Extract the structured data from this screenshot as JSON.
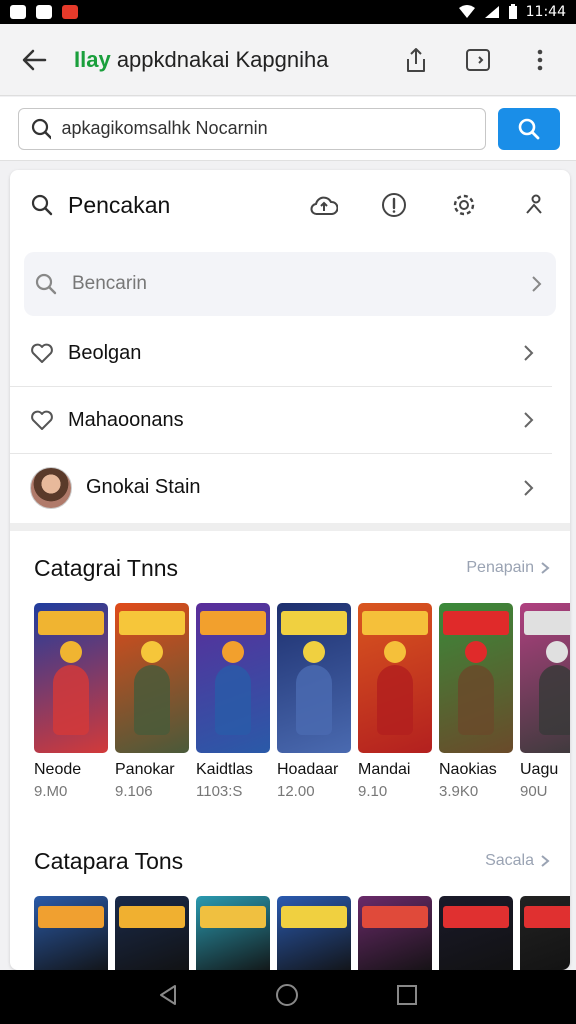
{
  "status_bar": {
    "time": "11:44"
  },
  "app_bar": {
    "title_accent": "Ilay",
    "title_rest": " appkdnakai Kapgniha"
  },
  "search": {
    "value": "apkagikomsalhk Nocarnin"
  },
  "menu": {
    "title": "Pencakan",
    "search_label": "Bencarin",
    "items": [
      {
        "label": "Beolgan",
        "icon": "heart-icon"
      },
      {
        "label": "Mahaoonans",
        "icon": "heart-icon"
      },
      {
        "label": "Gnokai Stain",
        "icon": "avatar"
      }
    ]
  },
  "section1": {
    "title": "Catagrai Tnns",
    "more": "Penapain",
    "tiles": [
      {
        "name": "Neode",
        "rating": "9.M0",
        "colors": [
          "#1f3c9e",
          "#d23a3a",
          "#f0b431"
        ]
      },
      {
        "name": "Panokar",
        "rating": "9.106",
        "colors": [
          "#e04b1a",
          "#4a5a3a",
          "#f6c63a"
        ]
      },
      {
        "name": "Kaidtlas",
        "rating": "1103:S",
        "colors": [
          "#5a2d9a",
          "#2a5aa8",
          "#f2a02d"
        ]
      },
      {
        "name": "Hoadaar",
        "rating": "12.00",
        "colors": [
          "#1d2f6e",
          "#4a6ab0",
          "#f0d040"
        ]
      },
      {
        "name": "Mandai",
        "rating": "9.10",
        "colors": [
          "#d9561f",
          "#b3201f",
          "#f5c03a"
        ]
      },
      {
        "name": "Naokias",
        "rating": "3.9K0",
        "colors": [
          "#3a8a3a",
          "#6a4a2a",
          "#e02a2a"
        ]
      },
      {
        "name": "Uagu",
        "rating": "90U",
        "colors": [
          "#b04080",
          "#3a3a3a",
          "#e0e0e0"
        ]
      }
    ]
  },
  "section2": {
    "title": "Catapara Tons",
    "more": "Sacala",
    "tiles": [
      {
        "colors": [
          "#2a5aa8",
          "#f0a030"
        ]
      },
      {
        "colors": [
          "#1a2a4a",
          "#f0b030"
        ]
      },
      {
        "colors": [
          "#2a9ab0",
          "#f0c040"
        ]
      },
      {
        "colors": [
          "#2a5ab0",
          "#f0d040"
        ]
      },
      {
        "colors": [
          "#6a2a6a",
          "#e04a3a"
        ]
      },
      {
        "colors": [
          "#1a1a2a",
          "#e03030"
        ]
      },
      {
        "colors": [
          "#222222",
          "#e03030"
        ]
      }
    ]
  },
  "colors": {
    "accent_blue": "#1a8ee8",
    "brand_green": "#1a9f3c"
  }
}
